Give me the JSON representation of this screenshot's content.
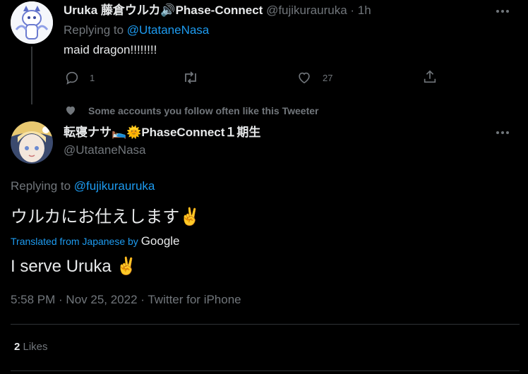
{
  "parent_tweet": {
    "author_name": "Uruka 藤倉ウルカ🔊Phase-Connect",
    "handle": "@fujikurauruka",
    "separator": "·",
    "time": "1h",
    "replying_prefix": "Replying to ",
    "replying_to": "@UtataneNasa",
    "text": "maid dragon!!!!!!!!",
    "reply_count": "1",
    "like_count": "27"
  },
  "social_context": "Some accounts you follow often like this Tweeter",
  "main_tweet": {
    "author_name": "転寝ナサ🛌🌞PhaseConnect１期生",
    "handle": "@UtataneNasa",
    "replying_prefix": "Replying to ",
    "replying_to": "@fujikurauruka",
    "text": "ウルカにお仕えします✌️",
    "translated_label": "Translated from Japanese by",
    "translator": "Google",
    "translation": "I serve Uruka ✌️",
    "timestamp": "5:58 PM · Nov 25, 2022 · Twitter for iPhone",
    "likes_count": "2",
    "likes_label": " Likes"
  },
  "colors": {
    "background": "#000000",
    "text": "#e7e9ea",
    "muted": "#71767b",
    "link": "#1d9bf0",
    "divider": "#2f3336"
  },
  "icons": [
    "reply-icon",
    "retweet-icon",
    "like-icon",
    "share-icon",
    "heart-filled-icon",
    "more-icon"
  ]
}
